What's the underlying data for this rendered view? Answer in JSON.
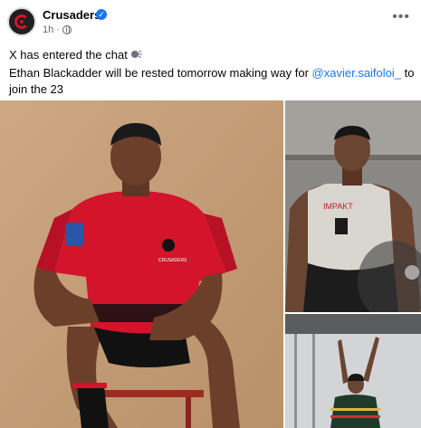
{
  "post": {
    "page_name": "Crusaders",
    "time": "1h",
    "more_label": "•••",
    "line1": "X has entered the chat",
    "line2_before": "Ethan Blackadder will be rested tomorrow making way for ",
    "mention": "@xavier.saifoloi_",
    "line2_after": " to join the 23"
  },
  "photos": {
    "main": {
      "jersey_sponsor": "CRUSADERS",
      "badge": "SUPER RUGBY"
    },
    "top_right": {
      "vest_brand": "IMPAKT"
    }
  },
  "colors": {
    "accent_blue": "#1877f2",
    "jersey_red": "#d3142b",
    "background_tan": "#c8a27c"
  }
}
